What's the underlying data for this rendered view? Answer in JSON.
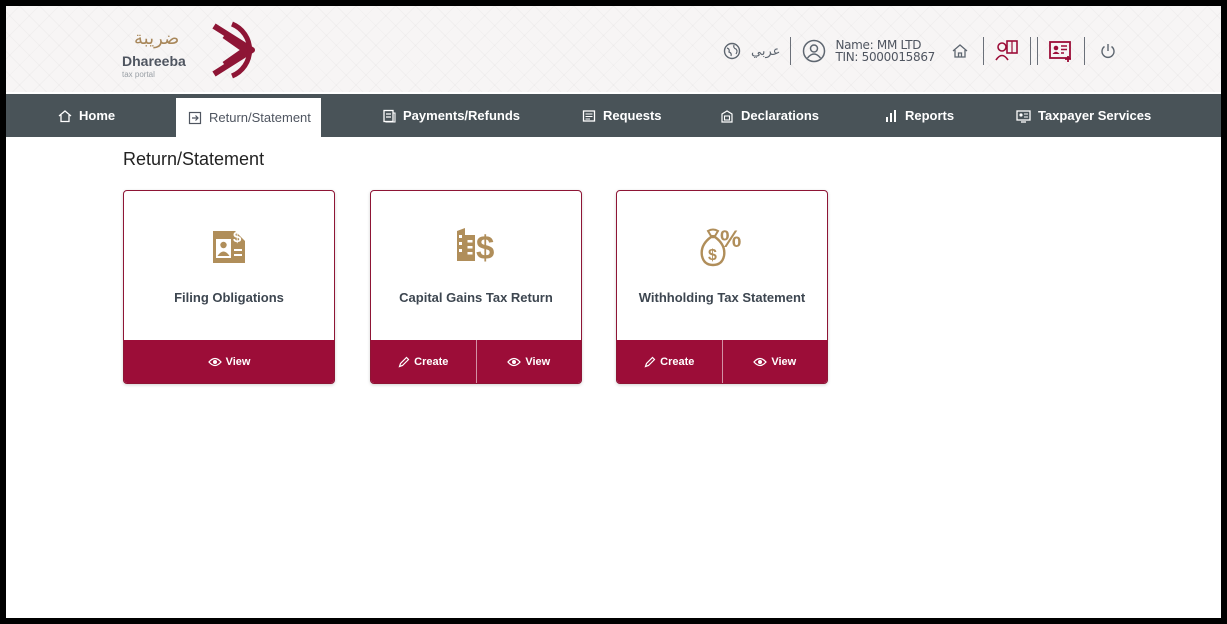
{
  "header": {
    "logo": {
      "arabic": "ضريبة",
      "name": "Dhareeba",
      "tagline": "tax portal"
    },
    "language_label": "عربي",
    "user": {
      "name": "Name: MM LTD",
      "tin": "TIN: 5000015867"
    },
    "icons": [
      "globe-icon",
      "user-icon",
      "home-icon",
      "user-book-icon",
      "contact-card-icon",
      "power-icon"
    ]
  },
  "nav": {
    "items": [
      {
        "label": "Home",
        "icon": "home-icon"
      },
      {
        "label": "Return/Statement",
        "icon": "return-icon",
        "active": true
      },
      {
        "label": "Payments/Refunds",
        "icon": "payments-icon"
      },
      {
        "label": "Requests",
        "icon": "requests-icon"
      },
      {
        "label": "Declarations",
        "icon": "declarations-icon"
      },
      {
        "label": "Reports",
        "icon": "reports-icon"
      },
      {
        "label": "Taxpayer Services",
        "icon": "taxpayer-services-icon"
      }
    ]
  },
  "page": {
    "title": "Return/Statement"
  },
  "cards": [
    {
      "title": "Filing Obligations",
      "icon": "filing-document-icon",
      "actions": [
        "View"
      ]
    },
    {
      "title": "Capital Gains Tax Return",
      "icon": "building-dollar-icon",
      "actions": [
        "Create",
        "View"
      ]
    },
    {
      "title": "Withholding Tax Statement",
      "icon": "money-bag-percent-icon",
      "actions": [
        "Create",
        "View"
      ]
    }
  ],
  "colors": {
    "brand": "#9c0d38",
    "gold": "#a8875a",
    "nav": "#495358"
  }
}
